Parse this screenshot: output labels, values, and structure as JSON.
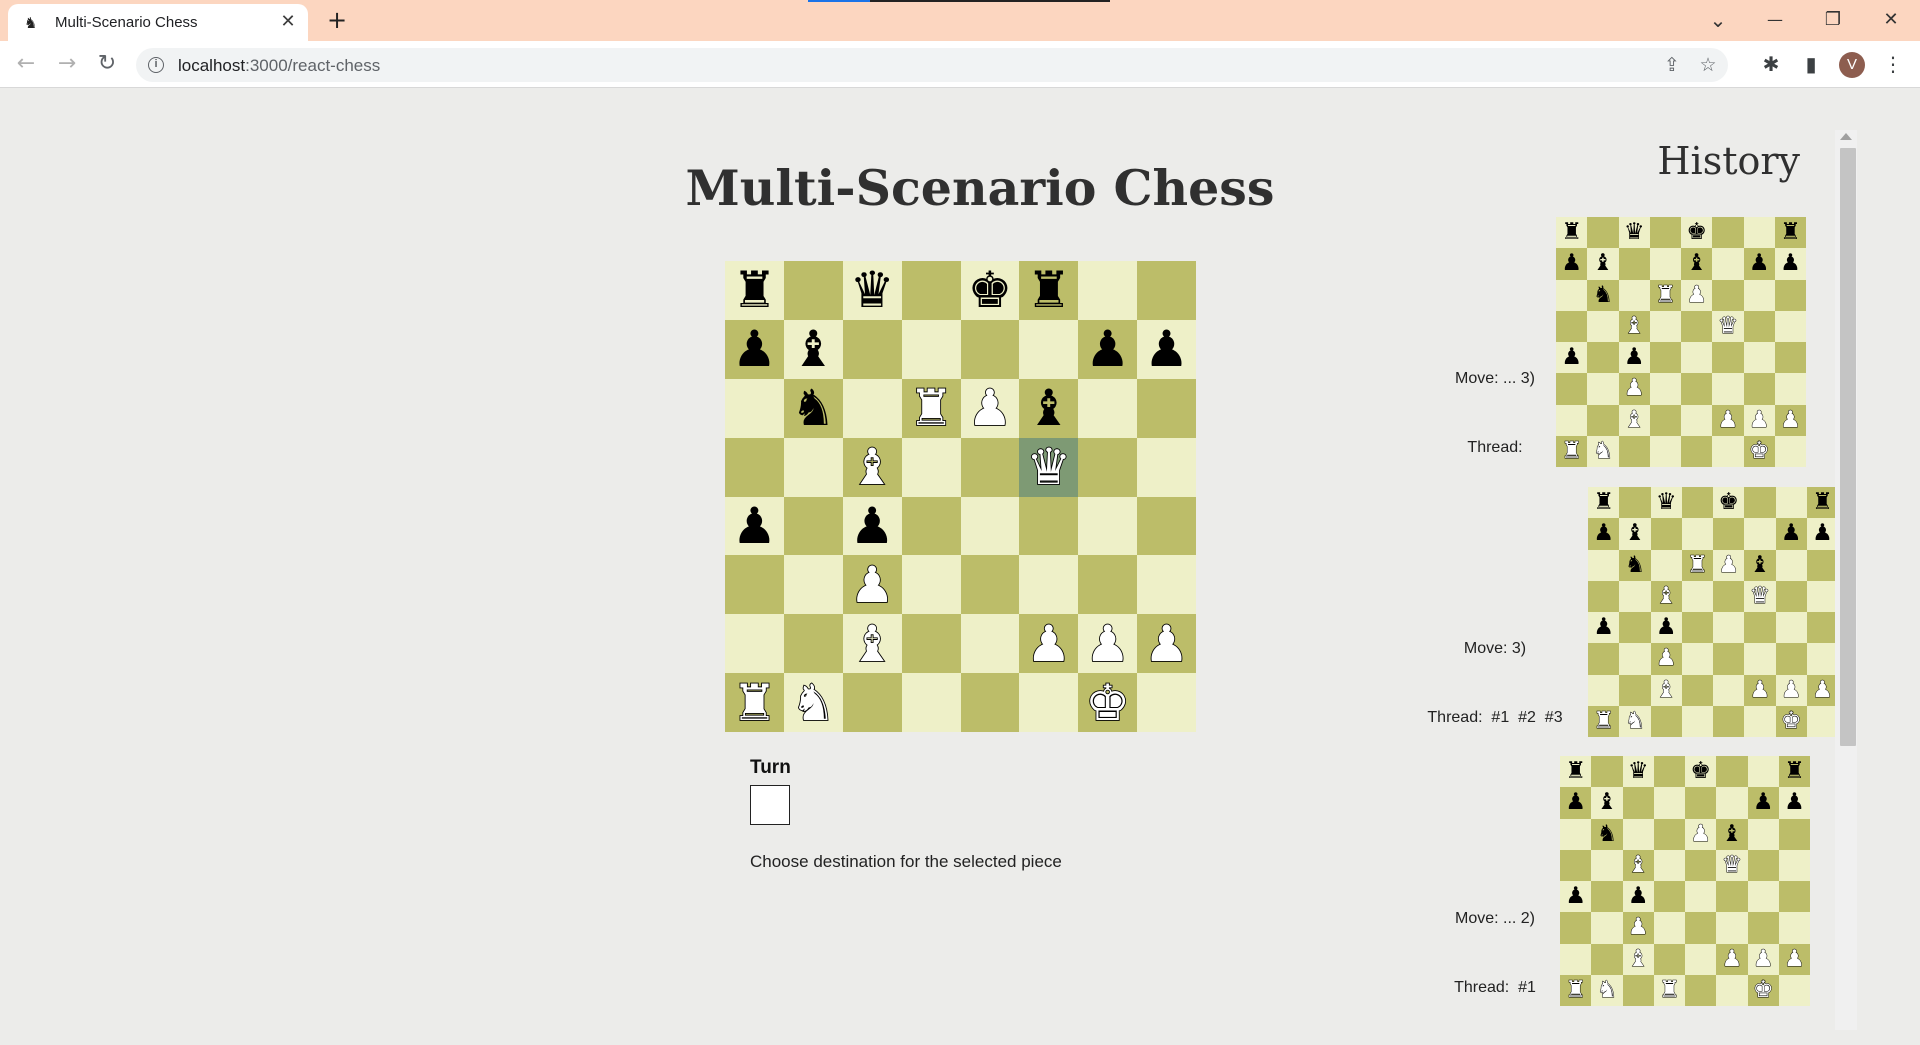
{
  "browser": {
    "tab_title": "Multi-Scenario Chess",
    "tab_favicon": "♞",
    "tab_close": "✕",
    "new_tab": "+",
    "url_host": "localhost",
    "url_path": ":3000/react-chess",
    "icons": [
      "back-arrow-icon",
      "forward-arrow-icon",
      "reload-icon",
      "info-icon",
      "share-icon",
      "star-icon",
      "extensions-icon",
      "sidebar-icon",
      "kebab-menu-icon"
    ],
    "avatar_letter": "V",
    "window_controls": {
      "dropdown": "⌄",
      "minimize": "—",
      "restore": "❐",
      "close": "✕"
    },
    "glyphs": {
      "back": "←",
      "forward": "→",
      "reload": "↻",
      "info": "i",
      "share": "⇪",
      "star": "☆",
      "extensions": "✱",
      "sidebar": "▮",
      "menu": "⋮"
    }
  },
  "page": {
    "title": "Multi-Scenario Chess",
    "turn_label": "Turn",
    "turn_color": "white",
    "status": "Choose destination for the selected piece",
    "history_title": "History"
  },
  "colors": {
    "light_square": "#eef0c8",
    "dark_square": "#bcbd69",
    "selected_square": "#7e9a74",
    "background": "#ececea",
    "tab_strip": "#fcd6c0"
  },
  "main_board": {
    "selected": [
      3,
      5
    ],
    "rows": [
      [
        "br",
        "",
        "bq",
        "",
        "bk",
        "br",
        "",
        ""
      ],
      [
        "bp",
        "bb",
        "",
        "",
        "",
        "",
        "bp",
        "bp"
      ],
      [
        "",
        "bn",
        "",
        "wr",
        "wp",
        "bb",
        "",
        ""
      ],
      [
        "",
        "",
        "wb",
        "",
        "",
        "wq",
        "",
        ""
      ],
      [
        "bp",
        "",
        "bp",
        "",
        "",
        "",
        "",
        ""
      ],
      [
        "",
        "",
        "wp",
        "",
        "",
        "",
        "",
        ""
      ],
      [
        "",
        "",
        "wb",
        "",
        "",
        "wp",
        "wp",
        "wp"
      ],
      [
        "wr",
        "wn",
        "",
        "",
        "",
        "",
        "wk",
        ""
      ]
    ]
  },
  "history": [
    {
      "move": "Move: ... 3)",
      "thread": "Thread:",
      "rows": [
        [
          "br",
          "",
          "bq",
          "",
          "bk",
          "",
          "",
          "br"
        ],
        [
          "bp",
          "bb",
          "",
          "",
          "bb",
          "",
          "bp",
          "bp"
        ],
        [
          "",
          "bn",
          "",
          "wr",
          "wp",
          "",
          "",
          ""
        ],
        [
          "",
          "",
          "wb",
          "",
          "",
          "wq",
          "",
          ""
        ],
        [
          "bp",
          "",
          "bp",
          "",
          "",
          "",
          "",
          ""
        ],
        [
          "",
          "",
          "wp",
          "",
          "",
          "",
          "",
          ""
        ],
        [
          "",
          "",
          "wb",
          "",
          "",
          "wp",
          "wp",
          "wp"
        ],
        [
          "wr",
          "wn",
          "",
          "",
          "",
          "",
          "wk",
          ""
        ]
      ]
    },
    {
      "move": "Move: 3)",
      "thread": "Thread:  #1  #2  #3",
      "rows": [
        [
          "br",
          "",
          "bq",
          "",
          "bk",
          "",
          "",
          "br"
        ],
        [
          "bp",
          "bb",
          "",
          "",
          "",
          "",
          "bp",
          "bp"
        ],
        [
          "",
          "bn",
          "",
          "wr",
          "wp",
          "bb",
          "",
          ""
        ],
        [
          "",
          "",
          "wb",
          "",
          "",
          "wq",
          "",
          ""
        ],
        [
          "bp",
          "",
          "bp",
          "",
          "",
          "",
          "",
          ""
        ],
        [
          "",
          "",
          "wp",
          "",
          "",
          "",
          "",
          ""
        ],
        [
          "",
          "",
          "wb",
          "",
          "",
          "wp",
          "wp",
          "wp"
        ],
        [
          "wr",
          "wn",
          "",
          "",
          "",
          "",
          "wk",
          ""
        ]
      ]
    },
    {
      "move": "Move: ... 2)",
      "thread": "Thread:  #1",
      "rows": [
        [
          "br",
          "",
          "bq",
          "",
          "bk",
          "",
          "",
          "br"
        ],
        [
          "bp",
          "bb",
          "",
          "",
          "",
          "",
          "bp",
          "bp"
        ],
        [
          "",
          "bn",
          "",
          "",
          "wp",
          "bb",
          "",
          ""
        ],
        [
          "",
          "",
          "wb",
          "",
          "",
          "wq",
          "",
          ""
        ],
        [
          "bp",
          "",
          "bp",
          "",
          "",
          "",
          "",
          ""
        ],
        [
          "",
          "",
          "wp",
          "",
          "",
          "",
          "",
          ""
        ],
        [
          "",
          "",
          "wb",
          "",
          "",
          "wp",
          "wp",
          "wp"
        ],
        [
          "wr",
          "wn",
          "",
          "wr",
          "",
          "",
          "wk",
          ""
        ]
      ]
    }
  ]
}
